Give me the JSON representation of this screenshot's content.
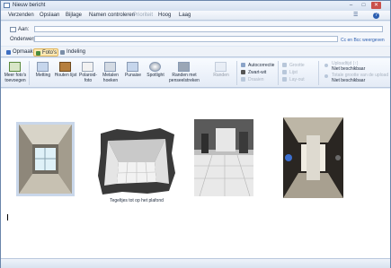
{
  "window": {
    "title": "Nieuw bericht",
    "min_glyph": "–",
    "max_glyph": "□",
    "close_glyph": "✕"
  },
  "menu": {
    "items": [
      "Verzenden",
      "Opslaan",
      "Bijlage",
      "Namen controleren",
      "Prioriteit",
      "Hoog",
      "Laag"
    ],
    "disabled_index": 4,
    "right_icon_glyph": "☰",
    "help_glyph": "?"
  },
  "header": {
    "aan_label": "Aan:",
    "onderwerp_label": "Onderwerp:",
    "cc_bcc_link": "Cc en Bcc weergeven"
  },
  "tabs": [
    "Opmaak",
    "Foto's",
    "Indeling"
  ],
  "active_tab": 1,
  "ribbon": {
    "buttons": [
      {
        "label": "Meer foto's toevoegen",
        "icon": "add-photos-icon"
      },
      {
        "label": "Metting",
        "icon": "frame-metting-icon"
      },
      {
        "label": "Houten lijst",
        "icon": "frame-wood-icon"
      },
      {
        "label": "Polaroid-foto",
        "icon": "frame-polaroid-icon"
      },
      {
        "label": "Metalen hoeken",
        "icon": "frame-metal-corners-icon"
      },
      {
        "label": "Punaise",
        "icon": "frame-pushpin-icon"
      },
      {
        "label": "Spotlight",
        "icon": "frame-spotlight-icon"
      },
      {
        "label": "Randen met penseelstreken",
        "icon": "frame-brushstroke-icon"
      }
    ],
    "randen_label": "Randen",
    "autocorrectie": "Autocorrectie",
    "zwart_wit": "Zwart-wit",
    "draaien": "Draaien",
    "disabled_labels": [
      "Grootte",
      "Lijst",
      "Lay-out"
    ],
    "uploadtijd_label": "Uploadtijd (↑)",
    "uploadtijd_value": "Niet beschikbaar",
    "totale_grootte_label": "Totale grootte van de upload",
    "totale_grootte_value": "Niet beschikbaar"
  },
  "content": {
    "caption": "Tegeltjes tot op het plafond",
    "photos": [
      "photo-ceiling-skylight",
      "photo-tiles-brushstroke",
      "photo-hall-floor",
      "photo-pillar-spotlight"
    ]
  },
  "colors": {
    "accent": "#2a5db0",
    "active_tab": "#fde9b4"
  }
}
